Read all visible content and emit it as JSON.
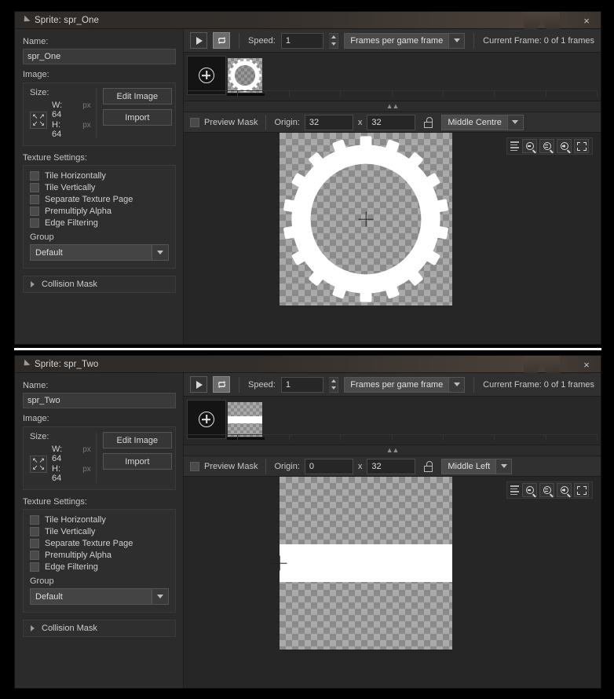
{
  "windows": [
    {
      "title": "Sprite: spr_One",
      "close_label": "×",
      "left": {
        "name_label": "Name:",
        "name_value": "spr_One",
        "image_label": "Image:",
        "size_label": "Size:",
        "width_text": "W: 64",
        "height_text": "H: 64",
        "px_unit": "px",
        "edit_image_label": "Edit Image",
        "import_label": "Import",
        "texture_settings_label": "Texture Settings:",
        "checkboxes": [
          {
            "label": "Tile Horizontally",
            "checked": false
          },
          {
            "label": "Tile Vertically",
            "checked": false
          },
          {
            "label": "Separate Texture Page",
            "checked": false
          },
          {
            "label": "Premultiply Alpha",
            "checked": false
          },
          {
            "label": "Edge Filtering",
            "checked": false
          }
        ],
        "group_label": "Group",
        "group_value": "Default",
        "collision_mask_label": "Collision Mask"
      },
      "toolbar": {
        "play_icon": "play-icon",
        "loop_icon": "loop-icon",
        "loop_active": true,
        "speed_label": "Speed:",
        "speed_value": "1",
        "speed_unit_value": "Frames per game frame",
        "current_frame_text": "Current Frame: 0 of 1 frames"
      },
      "mask_toolbar": {
        "preview_mask_label": "Preview Mask",
        "preview_mask_checked": false,
        "origin_label": "Origin:",
        "origin_x": "32",
        "origin_sep": "x",
        "origin_y": "32",
        "lock_icon": "unlock-icon",
        "origin_preset": "Middle Centre"
      },
      "zoom_tools": {
        "list_icon": "list-icon",
        "zoom_out_icon": "zoom-out-icon",
        "zoom_reset_icon": "zoom-reset-icon",
        "zoom_in_icon": "zoom-in-icon",
        "fit_icon": "fit-to-window-icon"
      },
      "sprite_kind": "gear"
    },
    {
      "title": "Sprite: spr_Two",
      "close_label": "×",
      "left": {
        "name_label": "Name:",
        "name_value": "spr_Two",
        "image_label": "Image:",
        "size_label": "Size:",
        "width_text": "W: 64",
        "height_text": "H: 64",
        "px_unit": "px",
        "edit_image_label": "Edit Image",
        "import_label": "Import",
        "texture_settings_label": "Texture Settings:",
        "checkboxes": [
          {
            "label": "Tile Horizontally",
            "checked": false
          },
          {
            "label": "Tile Vertically",
            "checked": false
          },
          {
            "label": "Separate Texture Page",
            "checked": false
          },
          {
            "label": "Premultiply Alpha",
            "checked": false
          },
          {
            "label": "Edge Filtering",
            "checked": false
          }
        ],
        "group_label": "Group",
        "group_value": "Default",
        "collision_mask_label": "Collision Mask"
      },
      "toolbar": {
        "play_icon": "play-icon",
        "loop_icon": "loop-icon",
        "loop_active": true,
        "speed_label": "Speed:",
        "speed_value": "1",
        "speed_unit_value": "Frames per game frame",
        "current_frame_text": "Current Frame: 0 of 1 frames"
      },
      "mask_toolbar": {
        "preview_mask_label": "Preview Mask",
        "preview_mask_checked": false,
        "origin_label": "Origin:",
        "origin_x": "0",
        "origin_sep": "x",
        "origin_y": "32",
        "lock_icon": "unlock-icon",
        "origin_preset": "Middle Left"
      },
      "zoom_tools": {
        "list_icon": "list-icon",
        "zoom_out_icon": "zoom-out-icon",
        "zoom_reset_icon": "zoom-reset-icon",
        "zoom_in_icon": "zoom-in-icon",
        "fit_icon": "fit-to-window-icon"
      },
      "sprite_kind": "bar"
    }
  ],
  "colors": {
    "window_bg": "#2b2b2b",
    "panel_bg": "#2e2e2e",
    "toolbar_bg": "#303030",
    "canvas_bg": "#262626",
    "title_accent": "#4a4039",
    "text": "#d0d0d0",
    "sprite_white": "#ffffff",
    "checker_light": "#aaaaaa",
    "checker_dark": "#8a8a8a"
  }
}
